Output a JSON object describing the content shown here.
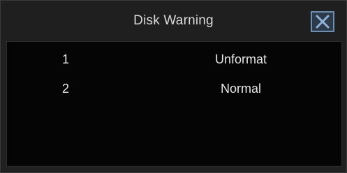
{
  "dialog": {
    "title": "Disk Warning",
    "close_icon": "close-x-icon"
  },
  "disks": [
    {
      "number": "1",
      "status": "Unformat"
    },
    {
      "number": "2",
      "status": "Normal"
    }
  ],
  "colors": {
    "background": "#000000",
    "title_bar": "#1f1f1f",
    "content_bg": "#050505",
    "text": "#e6e6e6",
    "close_border": "#6a8fb0"
  }
}
